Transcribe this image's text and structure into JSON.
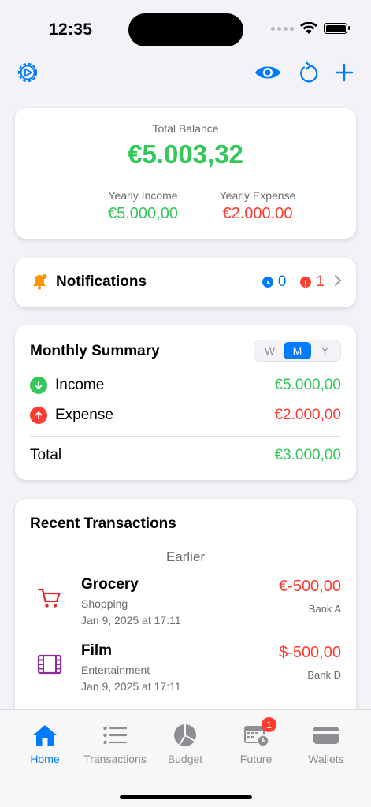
{
  "status_bar": {
    "time": "12:35"
  },
  "toolbar": {
    "settings_icon": "gear-play-icon",
    "visibility_icon": "eye-icon",
    "refresh_icon": "refresh-icon",
    "add_icon": "plus-icon"
  },
  "balance": {
    "total_label": "Total Balance",
    "total_value": "€5.003,32",
    "yearly_income_label": "Yearly Income",
    "yearly_income_value": "€5.000,00",
    "yearly_expense_label": "Yearly Expense",
    "yearly_expense_value": "€2.000,00"
  },
  "notifications": {
    "title": "Notifications",
    "pending_count": "0",
    "alert_count": "1"
  },
  "summary": {
    "title": "Monthly Summary",
    "periods": [
      "W",
      "M",
      "Y"
    ],
    "selected_period": "M",
    "income_label": "Income",
    "income_value": "€5.000,00",
    "expense_label": "Expense",
    "expense_value": "€2.000,00",
    "total_label": "Total",
    "total_value": "€3.000,00"
  },
  "recent": {
    "title": "Recent Transactions",
    "section": "Earlier",
    "transactions": [
      {
        "name": "Grocery",
        "category": "Shopping",
        "date": "Jan 9, 2025 at 17:11",
        "amount": "€-500,00",
        "account": "Bank A",
        "icon": "cart-icon"
      },
      {
        "name": "Film",
        "category": "Entertainment",
        "date": "Jan 9, 2025 at 17:11",
        "amount": "$-500,00",
        "account": "Bank D",
        "icon": "film-icon"
      }
    ]
  },
  "tabs": [
    {
      "label": "Home",
      "icon": "house-icon",
      "active": true
    },
    {
      "label": "Transactions",
      "icon": "list-icon",
      "active": false
    },
    {
      "label": "Budget",
      "icon": "pie-chart-icon",
      "active": false
    },
    {
      "label": "Future",
      "icon": "calendar-clock-icon",
      "active": false,
      "badge": "1"
    },
    {
      "label": "Wallets",
      "icon": "wallet-icon",
      "active": false
    }
  ],
  "colors": {
    "accent": "#007aff",
    "income": "#34c759",
    "expense": "#ff3b30",
    "notification_bell": "#ff9500",
    "film_icon": "#8e2c9c",
    "cart_icon": "#e0262f"
  }
}
